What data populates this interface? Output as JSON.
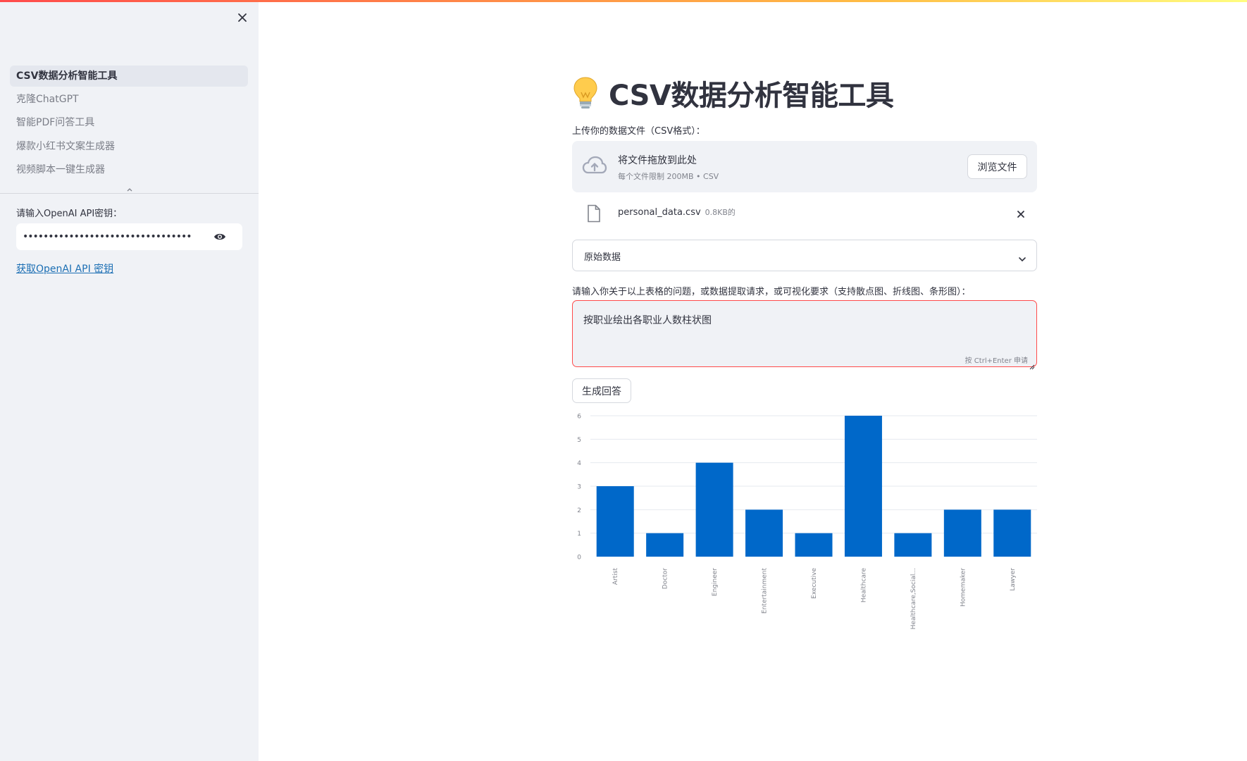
{
  "colors": {
    "accent": "#ff4b4b",
    "bar": "#0068c9",
    "link": "#1c6fb4",
    "sidebar_bg": "#f0f2f6"
  },
  "sidebar": {
    "close_icon": "close-icon",
    "items": [
      {
        "label": "CSV数据分析智能工具",
        "active": true
      },
      {
        "label": "克隆ChatGPT",
        "active": false
      },
      {
        "label": "智能PDF问答工具",
        "active": false
      },
      {
        "label": "爆款小红书文案生成器",
        "active": false
      },
      {
        "label": "视频脚本一键生成器",
        "active": false
      }
    ],
    "api_key_label": "请输入OpenAI API密钥：",
    "api_key_value": "••••••••••••••••••••••••••••••••••••••••••••••••••••",
    "api_link_text": "获取OpenAI API 密钥"
  },
  "main": {
    "title": "CSV数据分析智能工具",
    "title_icon": "lightbulb-icon",
    "upload": {
      "label": "上传你的数据文件（CSV格式）：",
      "drop_text": "将文件拖放到此处",
      "limit_text": "每个文件限制 200MB • CSV",
      "browse_label": "浏览文件"
    },
    "file": {
      "name": "personal_data.csv",
      "size": "0.8KB的"
    },
    "expander_label": "原始数据",
    "question": {
      "label": "请输入你关于以上表格的问题，或数据提取请求，或可视化要求（支持散点图、折线图、条形图）：",
      "value": "按职业绘出各职业人数柱状图",
      "hint": "按 Ctrl+Enter 申请"
    },
    "generate_label": "生成回答"
  },
  "chart_data": {
    "type": "bar",
    "categories": [
      "Artist",
      "Doctor",
      "Engineer",
      "Entertainment",
      "Executive",
      "Healthcare",
      "Healthcare,Social...",
      "Homemaker",
      "Lawyer"
    ],
    "values": [
      3,
      1,
      4,
      2,
      1,
      6,
      1,
      2,
      2
    ],
    "y_ticks": [
      0,
      1,
      2,
      3,
      4,
      5,
      6
    ],
    "ylim": [
      0,
      6
    ],
    "grid": true,
    "xlabel": "",
    "ylabel": ""
  }
}
